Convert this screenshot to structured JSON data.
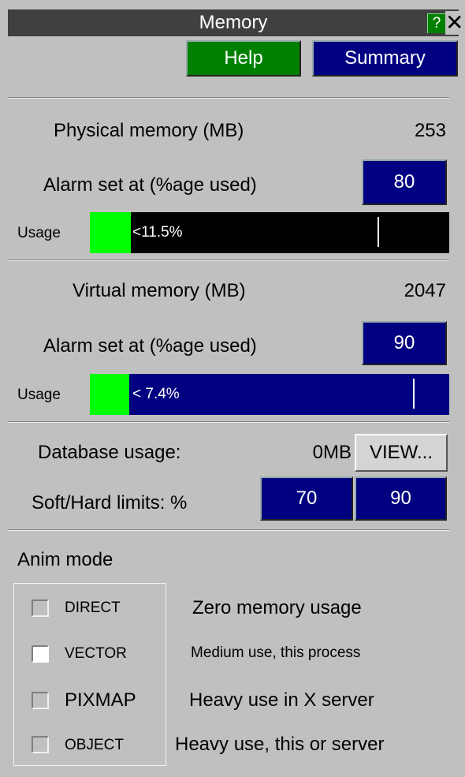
{
  "window": {
    "title": "Memory",
    "help_icon": "question-mark-icon",
    "help_icon_text": "?",
    "close_icon": "close-icon",
    "close_icon_text": "✕"
  },
  "toolbar": {
    "help_label": "Help",
    "summary_label": "Summary"
  },
  "physical": {
    "label": "Physical memory (MB)",
    "value": "253",
    "alarm_label": "Alarm set at (%age used)",
    "alarm_value": "80",
    "usage_label": "Usage",
    "usage_text": "<11.5%",
    "usage_fraction": 0.115,
    "alarm_fraction": 0.8,
    "bar_color": "#000000"
  },
  "virtual": {
    "label": "Virtual memory (MB)",
    "value": "2047",
    "alarm_label": "Alarm set at (%age used)",
    "alarm_value": "90",
    "usage_label": "Usage",
    "usage_text": "< 7.4%",
    "usage_fraction": 0.074,
    "alarm_fraction": 0.9,
    "bar_color": "#000080"
  },
  "database": {
    "label": "Database usage:",
    "value": "0MB",
    "view_label": "VIEW...",
    "limits_label": "Soft/Hard limits: %",
    "soft_limit": "70",
    "hard_limit": "90"
  },
  "anim": {
    "heading": "Anim mode",
    "options": [
      {
        "label": "DIRECT",
        "description": "Zero memory usage",
        "selected": false
      },
      {
        "label": "VECTOR",
        "description": "Medium use, this process",
        "selected": true
      },
      {
        "label": "PIXMAP",
        "description": "Heavy use in X server",
        "selected": false
      },
      {
        "label": "OBJECT",
        "description": "Heavy use, this or server",
        "selected": false
      }
    ]
  },
  "colors": {
    "green_fill": "#00ff00",
    "navy": "#000080",
    "title_bg": "#404040",
    "panel_bg": "#c0c0c0"
  }
}
